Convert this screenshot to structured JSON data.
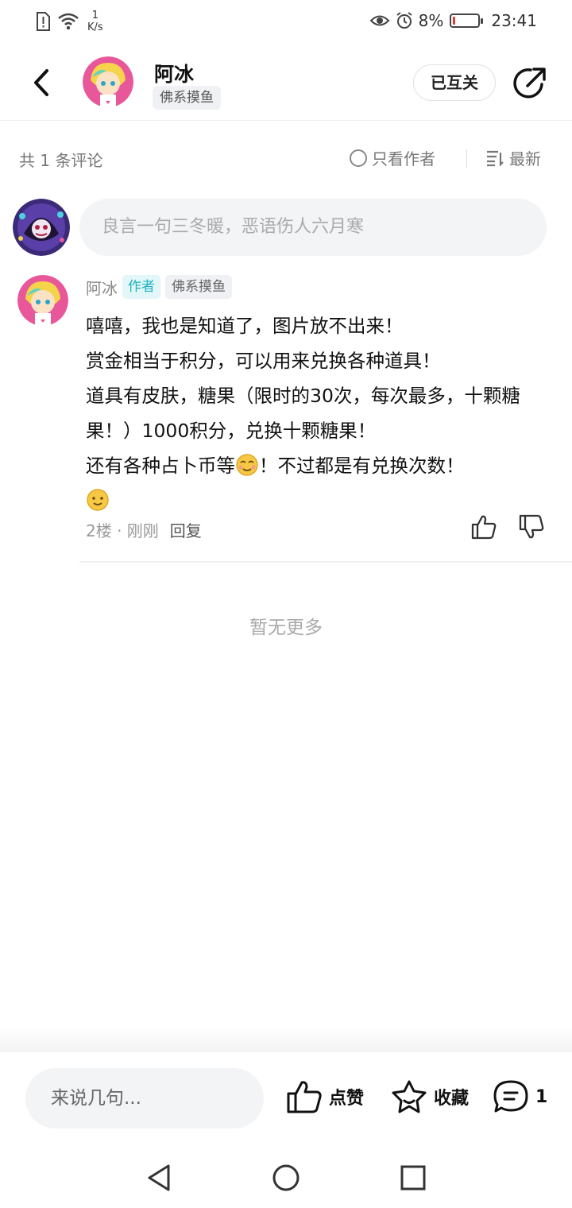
{
  "status_bar": {
    "speed_value": "1",
    "speed_unit": "K/s",
    "battery": "8%",
    "battery_level": 0.08,
    "time": "23:41"
  },
  "header": {
    "author_name": "阿冰",
    "author_tag": "佛系摸鱼",
    "follow_label": "已互关"
  },
  "filter": {
    "count_label": "共 1 条评论",
    "author_only_label": "只看作者",
    "sort_label": "最新"
  },
  "input": {
    "placeholder": "良言一句三冬暖，恶语伤人六月寒"
  },
  "comment": {
    "name": "阿冰",
    "author_badge": "作者",
    "tag": "佛系摸鱼",
    "lines": [
      "嘻嘻，我也是知道了，图片放不出来！",
      "赏金相当于积分，可以用来兑换各种道具！",
      "道具有皮肤，糖果（限时的30次，每次最多，十颗糖果！）1000积分，兑换十颗糖果！",
      "还有各种占卜币等",
      "！不过都是有兑换次数！"
    ],
    "floor_time": "2楼 · 刚刚",
    "reply_label": "回复"
  },
  "no_more": "暂无更多",
  "bottom_bar": {
    "input_placeholder": "来说几句...",
    "like_label": "点赞",
    "fav_label": "收藏",
    "comment_count": "1"
  },
  "colors": {
    "accent_teal": "#1bb3bd",
    "battery_low": "#e53935"
  },
  "icons": [
    "back-icon",
    "share-icon",
    "radio-icon",
    "sort-icon",
    "thumb-up-icon",
    "thumb-down-icon",
    "star-icon",
    "comment-icon",
    "nav-back-icon",
    "nav-home-icon",
    "nav-recents-icon"
  ]
}
